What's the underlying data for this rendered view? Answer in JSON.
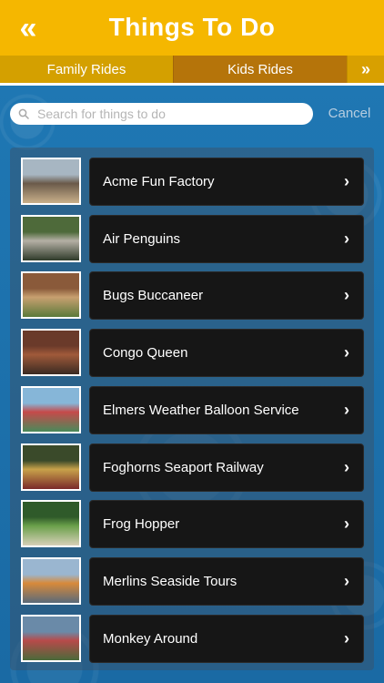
{
  "header": {
    "title": "Things To Do",
    "back_icon": "double-chevron-left-icon"
  },
  "tabs": [
    {
      "label": "Family Rides",
      "selected": false
    },
    {
      "label": "Kids Rides",
      "selected": true
    }
  ],
  "tabs_more_icon": "double-chevron-right-icon",
  "search": {
    "placeholder": "Search for things to do",
    "value": "",
    "cancel_label": "Cancel"
  },
  "items": [
    {
      "label": "Acme Fun Factory",
      "thumb_colors": [
        "#a7b6c2",
        "#6a5a4a",
        "#c9b08a"
      ]
    },
    {
      "label": "Air Penguins",
      "thumb_colors": [
        "#4e6a3a",
        "#b5b0a5",
        "#2f3b2a"
      ]
    },
    {
      "label": "Bugs Buccaneer",
      "thumb_colors": [
        "#8a5a3a",
        "#c8a070",
        "#5c7a3a"
      ]
    },
    {
      "label": "Congo Queen",
      "thumb_colors": [
        "#6a3a2a",
        "#a05a3a",
        "#3a2a22"
      ]
    },
    {
      "label": "Elmers Weather Balloon Service",
      "thumb_colors": [
        "#86b6d8",
        "#c64a4a",
        "#4a8a5a"
      ]
    },
    {
      "label": "Foghorns Seaport Railway",
      "thumb_colors": [
        "#3a4a2a",
        "#c8a24a",
        "#7a2a2a"
      ]
    },
    {
      "label": "Frog Hopper",
      "thumb_colors": [
        "#2f5a2a",
        "#6aa04a",
        "#d6d0b8"
      ]
    },
    {
      "label": "Merlins Seaside Tours",
      "thumb_colors": [
        "#9ab6d0",
        "#d88a3a",
        "#5a6a7a"
      ]
    },
    {
      "label": "Monkey Around",
      "thumb_colors": [
        "#6a8aa8",
        "#b84a4a",
        "#4a6a3a"
      ]
    }
  ],
  "colors": {
    "header_bg": "#f5b700",
    "tab_bg": "#d8a000",
    "tab_selected_bg": "#b5740a",
    "page_bg": "#1e6fa8",
    "row_bg": "#161616"
  }
}
